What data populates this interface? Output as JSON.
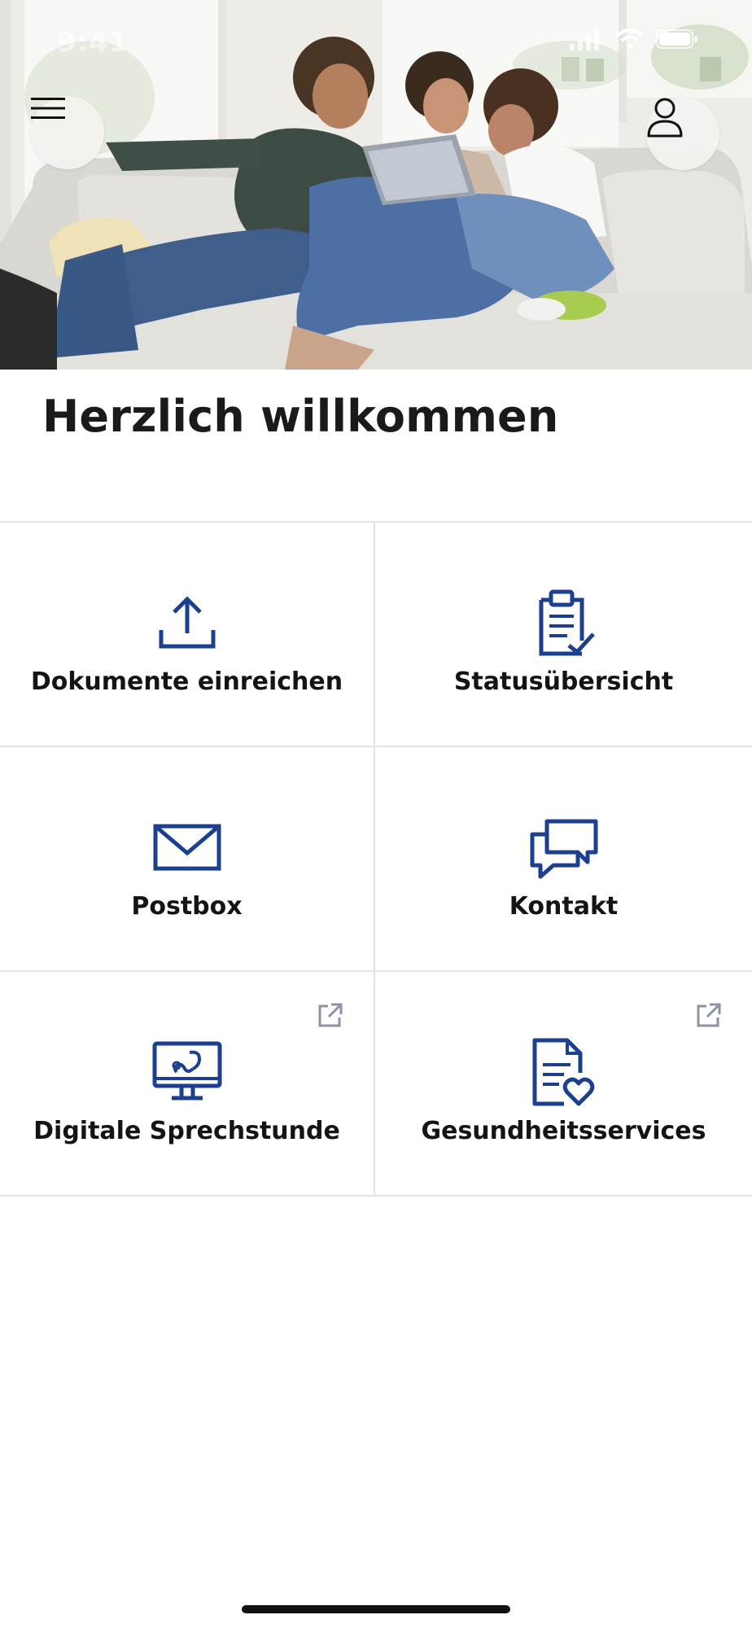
{
  "status_bar": {
    "time": "9:41"
  },
  "hero": {
    "image": "family-on-sofa-with-tablet"
  },
  "header": {
    "menu_icon": "hamburger-menu-icon",
    "profile_icon": "user-profile-icon"
  },
  "main": {
    "title": "Herzlich willkommen",
    "tiles": [
      {
        "label": "Dokumente einreichen",
        "icon": "upload-icon",
        "external": false
      },
      {
        "label": "Statusübersicht",
        "icon": "clipboard-check-icon",
        "external": false
      },
      {
        "label": "Postbox",
        "icon": "envelope-icon",
        "external": false
      },
      {
        "label": "Kontakt",
        "icon": "chat-bubbles-icon",
        "external": false
      },
      {
        "label": "Digitale Sprechstunde",
        "icon": "monitor-stethoscope-icon",
        "external": true
      },
      {
        "label": "Gesundheitsservices",
        "icon": "document-heart-icon",
        "external": true
      }
    ]
  },
  "colors": {
    "accent": "#1c3f8f",
    "divider": "#e3e3e3",
    "external_icon": "#8a93a6"
  }
}
